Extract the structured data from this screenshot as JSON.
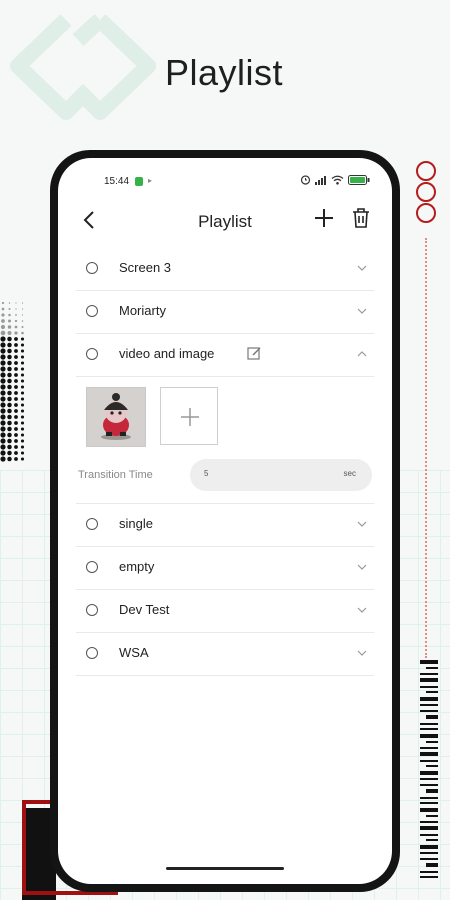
{
  "hero": {
    "title": "Playlist"
  },
  "status_bar": {
    "time": "15:44",
    "battery_icon": "battery-icon",
    "wifi_icon": "wifi-icon",
    "signal_icon": "signal-icon"
  },
  "appbar": {
    "title": "Playlist",
    "back_icon": "chevron-left-icon",
    "add_icon": "plus-icon",
    "delete_icon": "trash-icon"
  },
  "playlists": [
    {
      "name": "Screen 3",
      "expanded": false
    },
    {
      "name": "Moriarty",
      "expanded": false
    },
    {
      "name": "video and image",
      "expanded": true
    },
    {
      "name": "single",
      "expanded": false
    },
    {
      "name": "empty",
      "expanded": false
    },
    {
      "name": "Dev Test",
      "expanded": false
    },
    {
      "name": "WSA",
      "expanded": false
    }
  ],
  "expanded_panel": {
    "transition_label": "Transition Time",
    "transition_value": "5",
    "transition_unit": "sec"
  },
  "colors": {
    "accent_red": "#a01010",
    "grid_green": "#d9efe6",
    "text": "#222222"
  }
}
